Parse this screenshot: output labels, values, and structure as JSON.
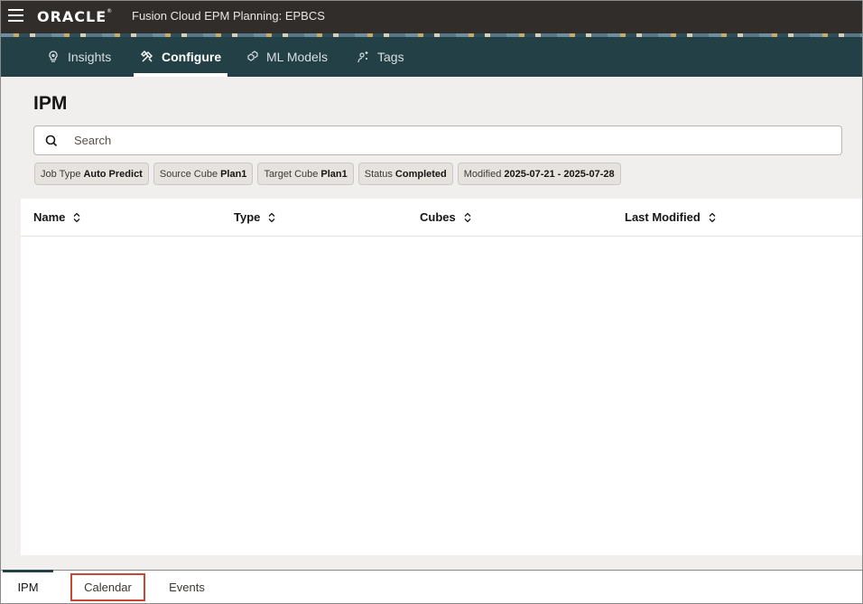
{
  "topbar": {
    "logo": "ORACLE",
    "app_title": "Fusion Cloud EPM Planning: EPBCS"
  },
  "nav": {
    "tabs": [
      {
        "label": "Insights",
        "icon": "lightbulb-icon",
        "active": false
      },
      {
        "label": "Configure",
        "icon": "tools-icon",
        "active": true
      },
      {
        "label": "ML Models",
        "icon": "cubes-icon",
        "active": false
      },
      {
        "label": "Tags",
        "icon": "sparkle-person-icon",
        "active": false
      }
    ]
  },
  "page": {
    "title": "IPM"
  },
  "search": {
    "placeholder": "Search",
    "value": ""
  },
  "filters": [
    {
      "key": "Job Type",
      "value": "Auto Predict"
    },
    {
      "key": "Source Cube",
      "value": "Plan1"
    },
    {
      "key": "Target Cube",
      "value": "Plan1"
    },
    {
      "key": "Status",
      "value": "Completed"
    },
    {
      "key": "Modified",
      "value": "2025-07-21 - 2025-07-28"
    }
  ],
  "table": {
    "columns": [
      "Name",
      "Type",
      "Cubes",
      "Last Modified"
    ],
    "rows": []
  },
  "bottom_tabs": [
    {
      "label": "IPM",
      "active": true
    },
    {
      "label": "Calendar",
      "active": false,
      "highlighted": true
    },
    {
      "label": "Events",
      "active": false
    }
  ],
  "colors": {
    "topbar": "#312d2a",
    "navbar": "#234047",
    "highlight": "#c74634"
  }
}
